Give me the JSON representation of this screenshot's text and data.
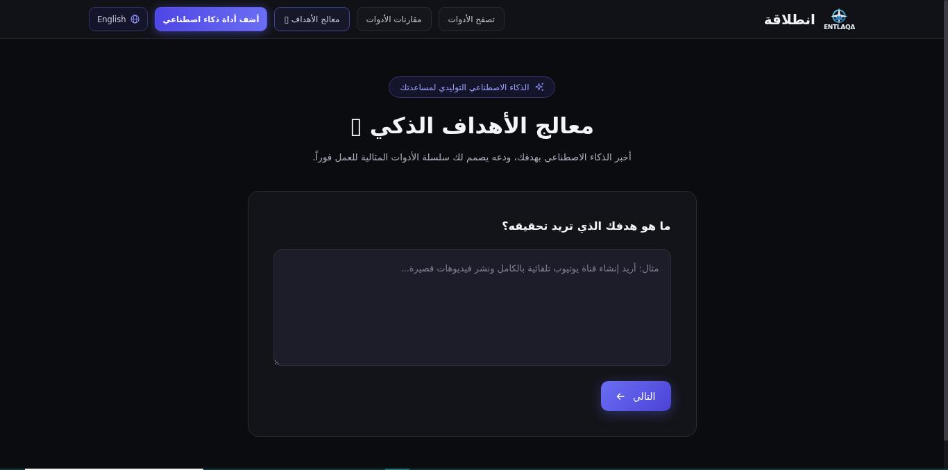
{
  "brand": {
    "name": "انطلاقة",
    "logo_text": "ENTLAQA"
  },
  "nav": {
    "links": [
      {
        "label": "تصفح الأدوات",
        "selected": false
      },
      {
        "label": "مقارنات الأدوات",
        "selected": false
      },
      {
        "label": "معالج الأهداف ▯",
        "selected": true
      }
    ],
    "add_tool_button": "أضف أداة ذكاء اصطناعي",
    "language_button": "English"
  },
  "hero": {
    "badge": "الذكاء الاصطناعي التوليدي لمساعدتك",
    "title": "معالج الأهداف الذكي ▯",
    "subtitle": "أخبر الذكاء الاصطناعي بهدفك، ودعه يصمم لك سلسلة الأدوات المثالية للعمل فوراً."
  },
  "card": {
    "question": "ما هو هدفك الذي تريد تحقيقه؟",
    "goal_field": {
      "placeholder": "مثال: أريد إنشاء قناة يوتيوب تلقائية بالكامل ونشر فيديوهات قصيرة..."
    },
    "next_button": "التالي"
  }
}
